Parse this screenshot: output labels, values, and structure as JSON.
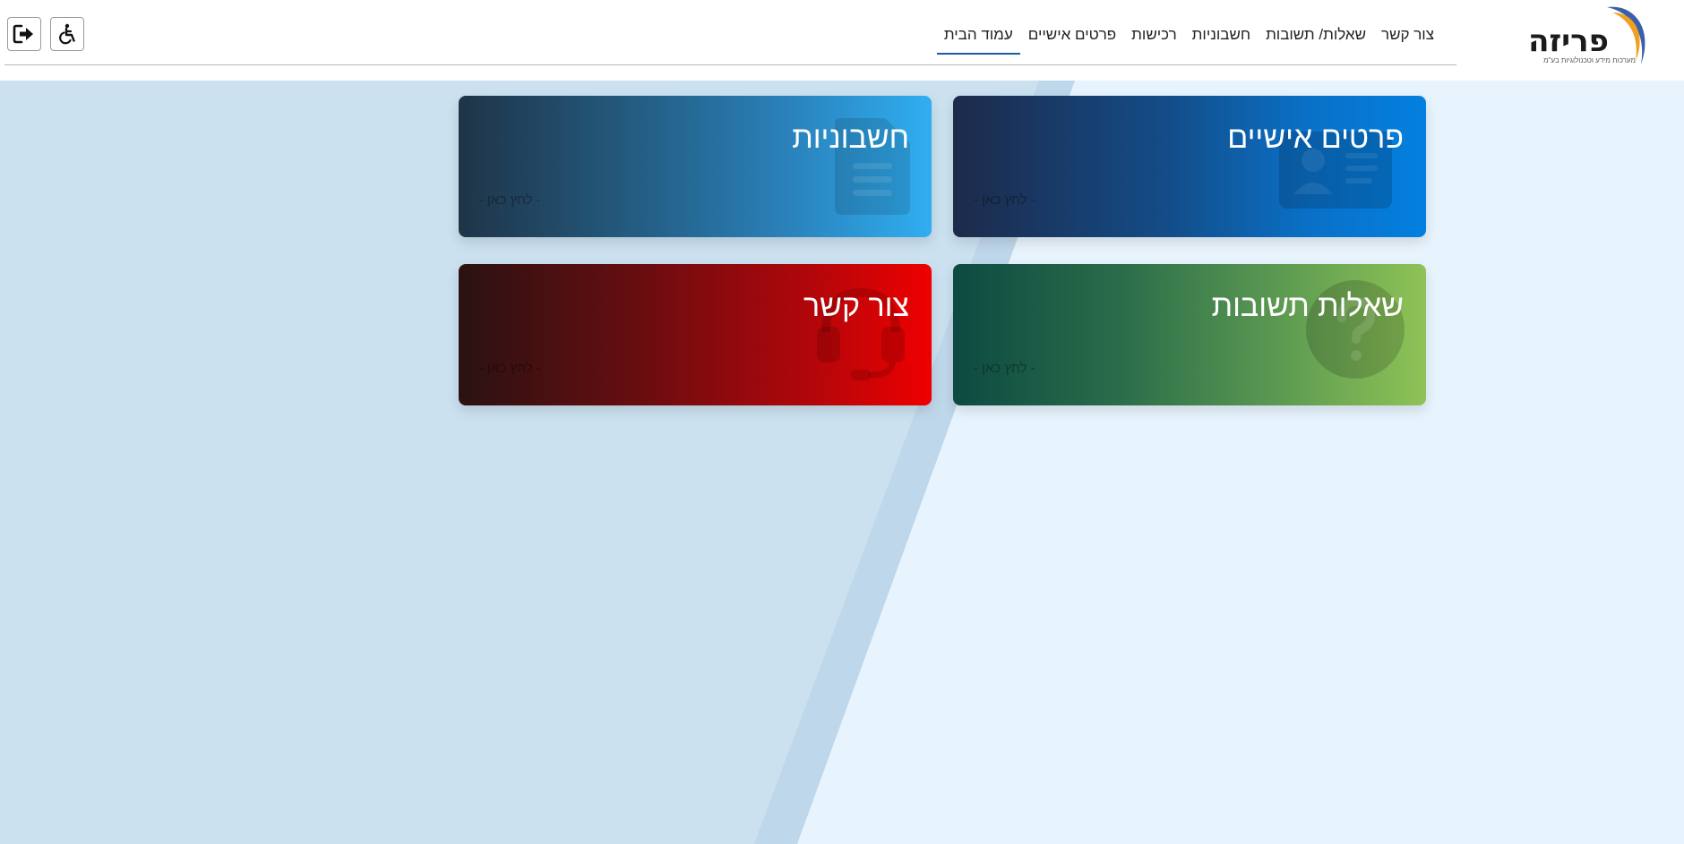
{
  "brand": {
    "name": "פריזה",
    "tagline": "מערכות מידע וטכנולוגיות בע\"מ",
    "colors": {
      "swoosh_blue": "#3b5fa8",
      "swoosh_orange": "#f0a020"
    }
  },
  "nav": {
    "items": [
      {
        "label": "עמוד הבית",
        "active": true
      },
      {
        "label": "פרטים אישיים"
      },
      {
        "label": "רכישות"
      },
      {
        "label": "חשבוניות"
      },
      {
        "label": "שאלות/ תשובות"
      },
      {
        "label": "צור קשר"
      }
    ],
    "active_color": "#1a5ba6"
  },
  "toolbar": {
    "accessibility_icon": "wheelchair-icon",
    "logout_icon": "logout-icon"
  },
  "cards": {
    "personal": {
      "title": "פרטים אישיים",
      "cta": "- לחץ כאן -",
      "icon": "id-card-icon",
      "color": "#0380e0"
    },
    "invoices": {
      "title": "חשבוניות",
      "cta": "- לחץ כאן -",
      "icon": "document-icon",
      "color": "#30aef1"
    },
    "faq": {
      "title": "שאלות תשובות",
      "cta": "- לחץ כאן -",
      "icon": "question-circle-icon",
      "color": "#8fc356"
    },
    "contact": {
      "title": "צור קשר",
      "cta": "- לחץ כאן -",
      "icon": "headset-icon",
      "color": "#ef0000"
    }
  }
}
